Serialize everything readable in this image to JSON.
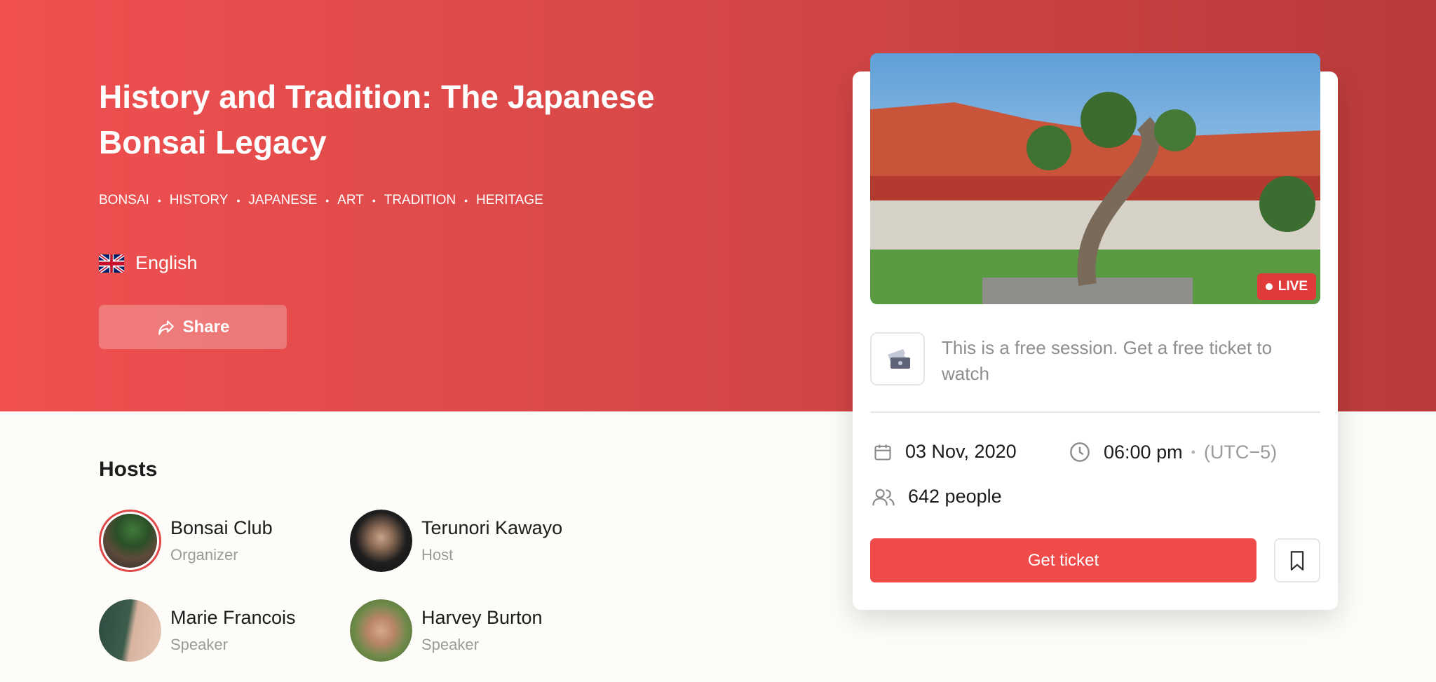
{
  "event": {
    "title": "History and Tradition: The Japanese Bonsai Legacy",
    "tags": [
      "BONSAI",
      "HISTORY",
      "JAPANESE",
      "ART",
      "TRADITION",
      "HERITAGE"
    ],
    "tag_separator": "•",
    "language": "English",
    "share_label": "Share"
  },
  "hosts": {
    "heading": "Hosts",
    "items": [
      {
        "name": "Bonsai Club",
        "role": "Organizer"
      },
      {
        "name": "Terunori Kawayo",
        "role": "Host"
      },
      {
        "name": "Marie Francois",
        "role": "Speaker"
      },
      {
        "name": "Harvey Burton",
        "role": "Speaker"
      }
    ]
  },
  "card": {
    "live_label": "LIVE",
    "free_text": "This is a free session. Get a free ticket to watch",
    "date": "03 Nov, 2020",
    "time": "06:00 pm",
    "time_separator": "•",
    "timezone": "(UTC−5)",
    "attendees": "642 people",
    "get_ticket_label": "Get ticket"
  },
  "colors": {
    "brand": "#ef4b4b",
    "hero_start": "#f05050",
    "hero_end": "#b93a3a",
    "muted": "#9a9a9a"
  },
  "icons": [
    "uk-flag-icon",
    "share-icon",
    "ticket-icon",
    "calendar-icon",
    "clock-icon",
    "people-icon",
    "bookmark-icon"
  ]
}
